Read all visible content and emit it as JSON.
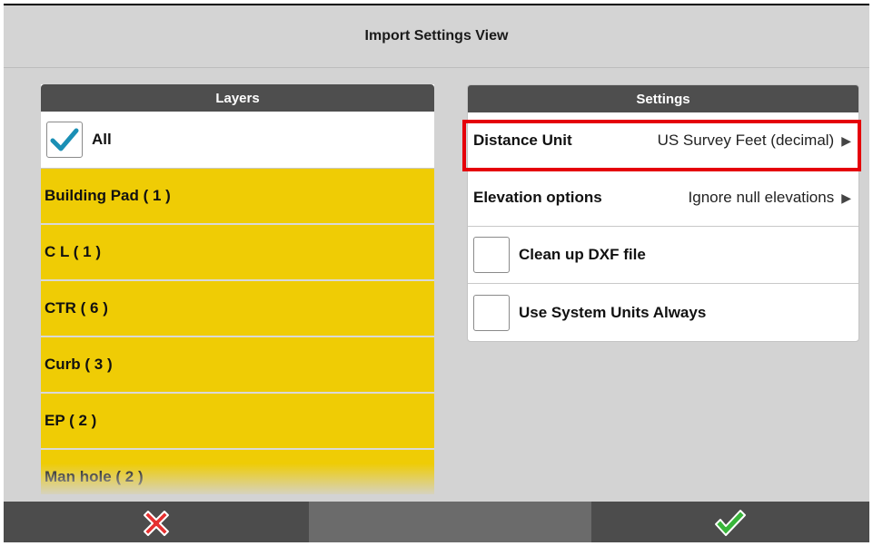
{
  "window": {
    "title": "Import Settings View"
  },
  "layers": {
    "header": "Layers",
    "all_label": "All",
    "all_checked": true,
    "items": [
      {
        "label": "Building Pad ( 1 )"
      },
      {
        "label": "C L ( 1 )"
      },
      {
        "label": "CTR ( 6 )"
      },
      {
        "label": "Curb ( 3 )"
      },
      {
        "label": "EP ( 2 )"
      },
      {
        "label": "Man hole ( 2 )"
      }
    ]
  },
  "settings": {
    "header": "Settings",
    "distance_unit": {
      "label": "Distance Unit",
      "value": "US Survey Feet (decimal)"
    },
    "elevation_options": {
      "label": "Elevation options",
      "value": "Ignore null elevations"
    },
    "clean_up_dxf": {
      "label": "Clean up DXF file",
      "checked": false
    },
    "use_system_units": {
      "label": "Use System Units Always",
      "checked": false
    }
  },
  "colors": {
    "layer_highlight": "#efcc05",
    "header_bg": "#4e4e4e",
    "check_accent": "#1a8fb5",
    "cancel_red": "#e53030",
    "ok_green": "#38b53a",
    "annotation_red": "#e5000a"
  },
  "icons": {
    "checkmark": "checkmark-icon",
    "arrow": "chevron-right-icon",
    "cancel": "cancel-x-icon",
    "ok": "ok-check-icon"
  }
}
